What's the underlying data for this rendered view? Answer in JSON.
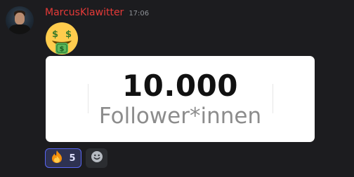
{
  "message": {
    "author": {
      "name": "MarcusKlawitter",
      "name_color": "#e63a38"
    },
    "timestamp": "17:06",
    "emoji": "money-mouth-face",
    "card": {
      "count": "10.000",
      "label": "Follower*innen"
    },
    "reactions": [
      {
        "emoji": "fire",
        "count": "5",
        "active": true
      }
    ],
    "add_reaction_icon": "smiley-add-icon"
  }
}
